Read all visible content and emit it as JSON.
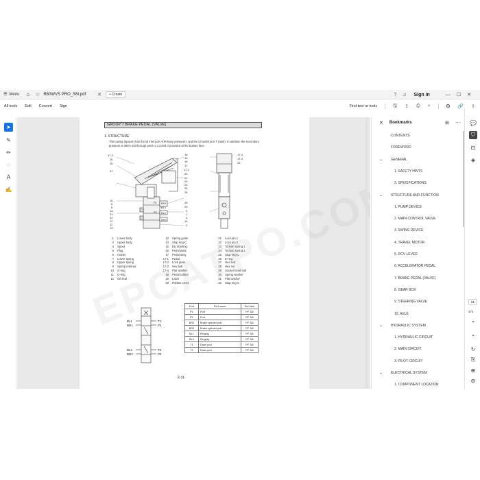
{
  "titlebar": {
    "menu_label": "Menu",
    "tab_title": "R60WVS PRO_SM.pdf",
    "create_label": "Create",
    "signin_label": "Sign in"
  },
  "toolbar": {
    "items": [
      "All tools",
      "Edit",
      "Convert",
      "Sign"
    ],
    "find_label": "Find text or tools"
  },
  "document": {
    "group_title": "GROUP  7  BRAKE PEDAL (VALVE)",
    "section_title": "1.  STRUCTURE",
    "section_text": "The casing (spacer) has the oil inlet port A(Primary pressure), and the oil outlet port T (tank).  In addition the secondary pressure is taken out through ports 1,2,3 and 4 provided at the bottom face.",
    "parts": [
      {
        "no": "1",
        "name": "Lower body"
      },
      {
        "no": "2",
        "name": "Upper body"
      },
      {
        "no": "4",
        "name": "Spool"
      },
      {
        "no": "5",
        "name": "Plug"
      },
      {
        "no": "6",
        "name": "Holder"
      },
      {
        "no": "7",
        "name": "Lower spring"
      },
      {
        "no": "8",
        "name": "Upper spring"
      },
      {
        "no": "9",
        "name": "Spring retainer"
      },
      {
        "no": "10",
        "name": "O-ring"
      },
      {
        "no": "11",
        "name": "O-ring"
      },
      {
        "no": "12",
        "name": "Oil seal"
      },
      {
        "no": "13",
        "name": "Spring guide"
      },
      {
        "no": "14",
        "name": "Stop ring-C"
      },
      {
        "no": "15",
        "name": "DU bushing"
      },
      {
        "no": "16",
        "name": "Pedal plate"
      },
      {
        "no": "17",
        "name": "Pedal assy"
      },
      {
        "no": "17-1",
        "name": "Pedal"
      },
      {
        "no": "17-2",
        "name": "Lock plate"
      },
      {
        "no": "17-3",
        "name": "Hex bolt"
      },
      {
        "no": "17-4",
        "name": "Plat washer"
      },
      {
        "no": "18",
        "name": "Pedal rubber"
      },
      {
        "no": "19",
        "name": "Latch"
      },
      {
        "no": "20",
        "name": "Rubber cover"
      },
      {
        "no": "21",
        "name": "Lock pin 1"
      },
      {
        "no": "22",
        "name": "Lock pin 2"
      },
      {
        "no": "23",
        "name": "Torsion spring 1"
      },
      {
        "no": "24",
        "name": "Torsion spring 2"
      },
      {
        "no": "25",
        "name": "Stop ring-C"
      },
      {
        "no": "26",
        "name": "E-ring"
      },
      {
        "no": "27",
        "name": "Hex bolt"
      },
      {
        "no": "28",
        "name": "Hex nut"
      },
      {
        "no": "29",
        "name": "Socket head bolt"
      },
      {
        "no": "30",
        "name": "Spring washer"
      },
      {
        "no": "31",
        "name": "Plat washer"
      },
      {
        "no": "32",
        "name": "Stop ring-C"
      }
    ],
    "port_table": {
      "headers": [
        "Port",
        "Port name",
        "Port size"
      ],
      "rows": [
        [
          "P1",
          "Port",
          "PF 3/8"
        ],
        [
          "P2",
          "Port",
          "PF 3/8"
        ],
        [
          "BR1",
          "Brake cylinder port",
          "PF 3/8"
        ],
        [
          "BR2",
          "Brake cylinder port",
          "PF 3/8"
        ],
        [
          "BL1",
          "Pluging",
          "PF 3/8"
        ],
        [
          "BL2",
          "Pluging",
          "PF 3/8"
        ],
        [
          "T1",
          "Drain port",
          "PF 3/8"
        ],
        [
          "T2",
          "Drain port",
          "PF 3/8"
        ]
      ]
    },
    "schematic_labels": {
      "bl1": "BL1",
      "br1": "BR1",
      "bl2": "BL2",
      "br2": "BR2",
      "t1": "T1",
      "p1": "P1",
      "t2": "T2",
      "p2": "P2"
    },
    "diagram_labels": {
      "left": [
        "17-2",
        "20",
        "26",
        "27",
        "15",
        "5",
        "6",
        "14",
        "31",
        "32",
        "12",
        "11",
        "13"
      ],
      "mid": [
        "18",
        "19",
        "16",
        "17",
        "17-1",
        "23",
        "21",
        "24",
        "22",
        "25",
        "26",
        "28",
        "29",
        "3",
        "1",
        "4",
        "10",
        "2"
      ],
      "right": [
        "17-4",
        "17-3",
        "25"
      ],
      "ports": [
        "BR1",
        "BR2",
        "BL1",
        "BL2",
        "P1",
        "P2"
      ]
    },
    "page_number": "2-31",
    "watermark": "EPCATPO.COM"
  },
  "bookmarks": {
    "title": "Bookmarks",
    "items": [
      {
        "label": "CONTENTS",
        "level": 0,
        "chevron": false
      },
      {
        "label": "FOREWORD",
        "level": 0,
        "chevron": false
      },
      {
        "label": "GENERAL",
        "level": 0,
        "chevron": true
      },
      {
        "label": "1. SAFETY HINTS",
        "level": 1,
        "chevron": false
      },
      {
        "label": "2. SPECIFICATIONS",
        "level": 1,
        "chevron": false
      },
      {
        "label": "STRUCTURE AND FUNCTION",
        "level": 0,
        "chevron": true
      },
      {
        "label": "1. PUMP DEVICE",
        "level": 1,
        "chevron": false
      },
      {
        "label": "2. MAIN CONTROL VALVE",
        "level": 1,
        "chevron": false
      },
      {
        "label": "3. SWING DEVICE",
        "level": 1,
        "chevron": false
      },
      {
        "label": "4. TRAVEL MOTOR",
        "level": 1,
        "chevron": false
      },
      {
        "label": "5. RCV LEVER",
        "level": 1,
        "chevron": false
      },
      {
        "label": "6. ACCELERATOR PEDAL",
        "level": 1,
        "chevron": false
      },
      {
        "label": "7. BRAKE PEDAL (VALVE)",
        "level": 1,
        "chevron": false
      },
      {
        "label": "8. GEAR BOX",
        "level": 1,
        "chevron": false
      },
      {
        "label": "9. STEERING VALVE",
        "level": 1,
        "chevron": false
      },
      {
        "label": "10. AXLE",
        "level": 1,
        "chevron": false
      },
      {
        "label": "HYDRAULIC SYSTEM",
        "level": 0,
        "chevron": true
      },
      {
        "label": "1. HYDRAULIC CIRCUIT",
        "level": 1,
        "chevron": false
      },
      {
        "label": "2. MAIN CIRCUIT",
        "level": 1,
        "chevron": false
      },
      {
        "label": "3. PILOT CIRCUIT",
        "level": 1,
        "chevron": false
      },
      {
        "label": "ELECTRICAL SYSTEM",
        "level": 0,
        "chevron": true
      },
      {
        "label": "1. COMPONENT LOCATION",
        "level": 1,
        "chevron": false
      }
    ]
  },
  "rightrail": {
    "current_page": "61",
    "total_pages": "474"
  }
}
